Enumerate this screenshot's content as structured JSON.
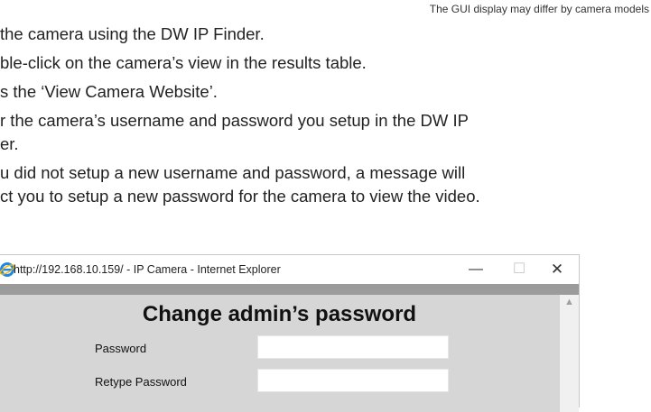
{
  "note": "The GUI display may differ by camera models",
  "instructions": [
    "the camera using the DW IP Finder.",
    "ble-click on the camera’s view in the results table.",
    "s the ‘View Camera Website’.",
    "r the camera’s username and password you setup in the DW IP",
    "er.",
    "u did not setup a new username and password, a message will",
    "ct you to setup a new password for the camera to view the video."
  ],
  "window": {
    "title": "http://192.168.10.159/ - IP Camera - Internet Explorer",
    "minimize": "—",
    "maximize": "☐",
    "close": "✕"
  },
  "form": {
    "heading": "Change admin’s password",
    "password_label": "Password",
    "retype_label": "Retype Password",
    "password_value": "",
    "retype_value": ""
  },
  "colors": {
    "content_bg": "#d6d6d6",
    "strip": "#9b9b9b",
    "ie_blue": "#1e88e5",
    "ie_gold": "#f2b705"
  }
}
